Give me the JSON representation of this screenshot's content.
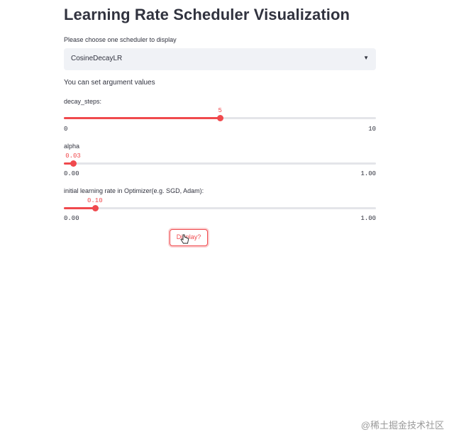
{
  "title": "Learning Rate Scheduler Visualization",
  "scheduler_select": {
    "label": "Please choose one scheduler to display",
    "value": "CosineDecayLR",
    "caret_icon": "caret-down-icon"
  },
  "info_text": "You can set argument values",
  "sliders": [
    {
      "label": "decay_steps:",
      "value": 5,
      "value_text": "5",
      "min_text": "0",
      "max_text": "10",
      "fraction": 0.5
    },
    {
      "label": "alpha",
      "value": 0.03,
      "value_text": "0.03",
      "min_text": "0.00",
      "max_text": "1.00",
      "fraction": 0.03
    },
    {
      "label": "initial learning rate in Optimizer(e.g. SGD, Adam):",
      "value": 0.1,
      "value_text": "0.10",
      "min_text": "0.00",
      "max_text": "1.00",
      "fraction": 0.1
    }
  ],
  "display_button": {
    "label": "Display?"
  },
  "watermark": "@稀土掘金技术社区",
  "colors": {
    "accent": "#f0494d",
    "track": "#e4e5e9",
    "select_bg": "#f0f2f6",
    "text": "#31333f"
  }
}
